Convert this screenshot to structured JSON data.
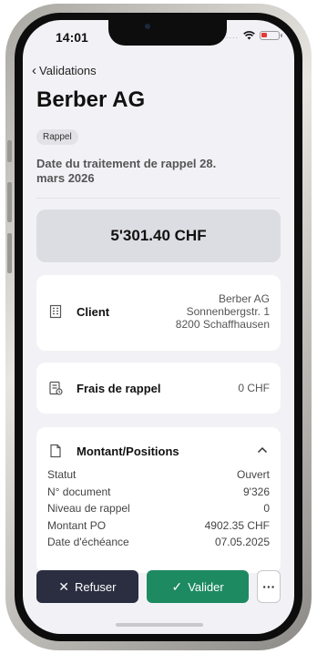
{
  "status_bar": {
    "time": "14:01",
    "signal": "....",
    "wifi_icon": "wifi-icon",
    "battery_icon": "battery-low-icon",
    "battery_color": "#e53935"
  },
  "nav": {
    "back_label": "Validations"
  },
  "page": {
    "title": "Berber AG",
    "tag": "Rappel",
    "subtitle": "Date du traitement de rappel 28. mars 2026"
  },
  "amount": {
    "value": "5'301.40 CHF"
  },
  "client": {
    "label": "Client",
    "address": [
      "Berber AG",
      "Sonnenbergstr. 1",
      "8200 Schaffhausen"
    ]
  },
  "frais": {
    "label": "Frais de rappel",
    "value": "0 CHF"
  },
  "montant": {
    "label": "Montant/Positions",
    "rows": [
      {
        "label": "Statut",
        "value": "Ouvert"
      },
      {
        "label": "N° document",
        "value": "9'326"
      },
      {
        "label": "Niveau de rappel",
        "value": "0"
      },
      {
        "label": "Montant PO",
        "value": "4902.35 CHF"
      },
      {
        "label": "Date d'échéance",
        "value": "07.05.2025"
      }
    ]
  },
  "actions": {
    "refuse": "Refuser",
    "validate": "Valider",
    "more": "···"
  },
  "colors": {
    "validate": "#1e8a61",
    "refuse": "#2b2e41",
    "amount_bg": "#dcdce3"
  }
}
